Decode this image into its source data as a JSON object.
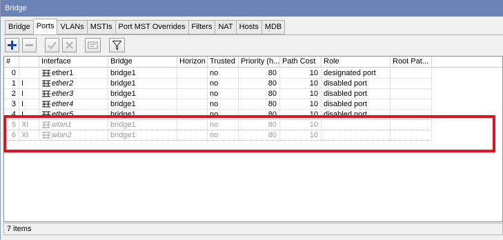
{
  "window": {
    "title": "Bridge"
  },
  "tabs": [
    {
      "label": "Bridge",
      "active": false
    },
    {
      "label": "Ports",
      "active": true
    },
    {
      "label": "VLANs",
      "active": false
    },
    {
      "label": "MSTIs",
      "active": false
    },
    {
      "label": "Port MST Overrides",
      "active": false
    },
    {
      "label": "Filters",
      "active": false
    },
    {
      "label": "NAT",
      "active": false
    },
    {
      "label": "Hosts",
      "active": false
    },
    {
      "label": "MDB",
      "active": false
    }
  ],
  "toolbar": {
    "buttons": [
      "plus-icon",
      "minus-icon",
      "check-icon",
      "cross-icon",
      "comment-icon",
      "filter-icon"
    ]
  },
  "table": {
    "columns": [
      "#",
      "",
      "Interface",
      "Bridge",
      "Horizon",
      "Trusted",
      "Priority (h...",
      "Path Cost",
      "Role",
      "Root Pat..."
    ],
    "rows": [
      {
        "num": "0",
        "flag": "",
        "interface": "ether1",
        "bridge": "bridge1",
        "horizon": "",
        "trusted": "no",
        "priority": "80",
        "path_cost": "10",
        "role": "designated port",
        "root_path": "",
        "disabled": false,
        "italic": false
      },
      {
        "num": "1",
        "flag": "I",
        "interface": "ether2",
        "bridge": "bridge1",
        "horizon": "",
        "trusted": "no",
        "priority": "80",
        "path_cost": "10",
        "role": "disabled port",
        "root_path": "",
        "disabled": false,
        "italic": true
      },
      {
        "num": "2",
        "flag": "I",
        "interface": "ether3",
        "bridge": "bridge1",
        "horizon": "",
        "trusted": "no",
        "priority": "80",
        "path_cost": "10",
        "role": "disabled port",
        "root_path": "",
        "disabled": false,
        "italic": true
      },
      {
        "num": "3",
        "flag": "I",
        "interface": "ether4",
        "bridge": "bridge1",
        "horizon": "",
        "trusted": "no",
        "priority": "80",
        "path_cost": "10",
        "role": "disabled port",
        "root_path": "",
        "disabled": false,
        "italic": true
      },
      {
        "num": "4",
        "flag": "I",
        "interface": "ether5",
        "bridge": "bridge1",
        "horizon": "",
        "trusted": "no",
        "priority": "80",
        "path_cost": "10",
        "role": "disabled port",
        "root_path": "",
        "disabled": false,
        "italic": true
      },
      {
        "num": "5",
        "flag": "XI",
        "interface": "wlan1",
        "bridge": "bridge1",
        "horizon": "",
        "trusted": "no",
        "priority": "80",
        "path_cost": "10",
        "role": "",
        "root_path": "",
        "disabled": true,
        "italic": true
      },
      {
        "num": "6",
        "flag": "XI",
        "interface": "wlan2",
        "bridge": "bridge1",
        "horizon": "",
        "trusted": "no",
        "priority": "80",
        "path_cost": "10",
        "role": "",
        "root_path": "",
        "disabled": true,
        "italic": true
      }
    ]
  },
  "status": {
    "items_text": "7 items"
  },
  "colors": {
    "titlebar": "#6b82b5",
    "highlight": "#e0141e",
    "disabled_text": "#9a9a9a"
  }
}
